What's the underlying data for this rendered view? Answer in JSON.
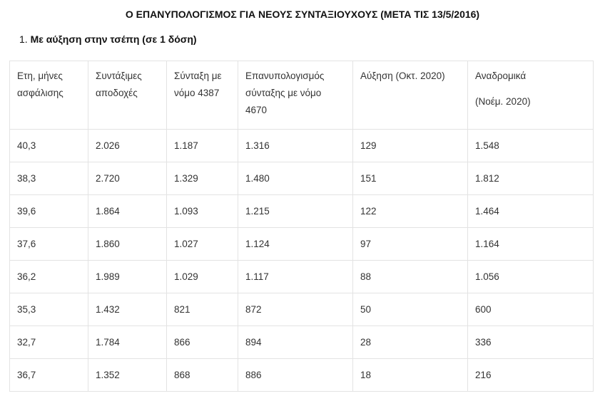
{
  "title": "Ο ΕΠΑΝΥΠΟΛΟΓΙΣΜΟΣ ΓΙΑ ΝΕΟΥΣ ΣΥΝΤΑΞΙΟΥΧΟΥΣ (ΜΕΤΑ ΤΙΣ 13/5/2016)",
  "section": {
    "number": "1.",
    "heading": "Με αύξηση στην τσέπη (σε 1 δόση)"
  },
  "table": {
    "headers": [
      "Ετη, μήνες ασφάλισης",
      "Συντάξιμες αποδοχές",
      "Σύνταξη με νόμο 4387",
      "Επανυπολογισμός σύνταξης με νόμο 4670",
      "Αύξηση (Οκτ. 2020)",
      "Αναδρομικά"
    ],
    "header_extra": "(Νοέμ. 2020)",
    "rows": [
      [
        "40,3",
        "2.026",
        "1.187",
        "1.316",
        "129",
        "1.548"
      ],
      [
        "38,3",
        "2.720",
        "1.329",
        "1.480",
        "151",
        "1.812"
      ],
      [
        "39,6",
        "1.864",
        "1.093",
        "1.215",
        "122",
        "1.464"
      ],
      [
        "37,6",
        "1.860",
        "1.027",
        "1.124",
        "97",
        "1.164"
      ],
      [
        "36,2",
        "1.989",
        "1.029",
        "1.117",
        "88",
        "1.056"
      ],
      [
        "35,3",
        "1.432",
        "821",
        "872",
        "50",
        "600"
      ],
      [
        "32,7",
        "1.784",
        "866",
        "894",
        "28",
        "336"
      ],
      [
        "36,7",
        "1.352",
        "868",
        "886",
        "18",
        "216"
      ]
    ]
  }
}
